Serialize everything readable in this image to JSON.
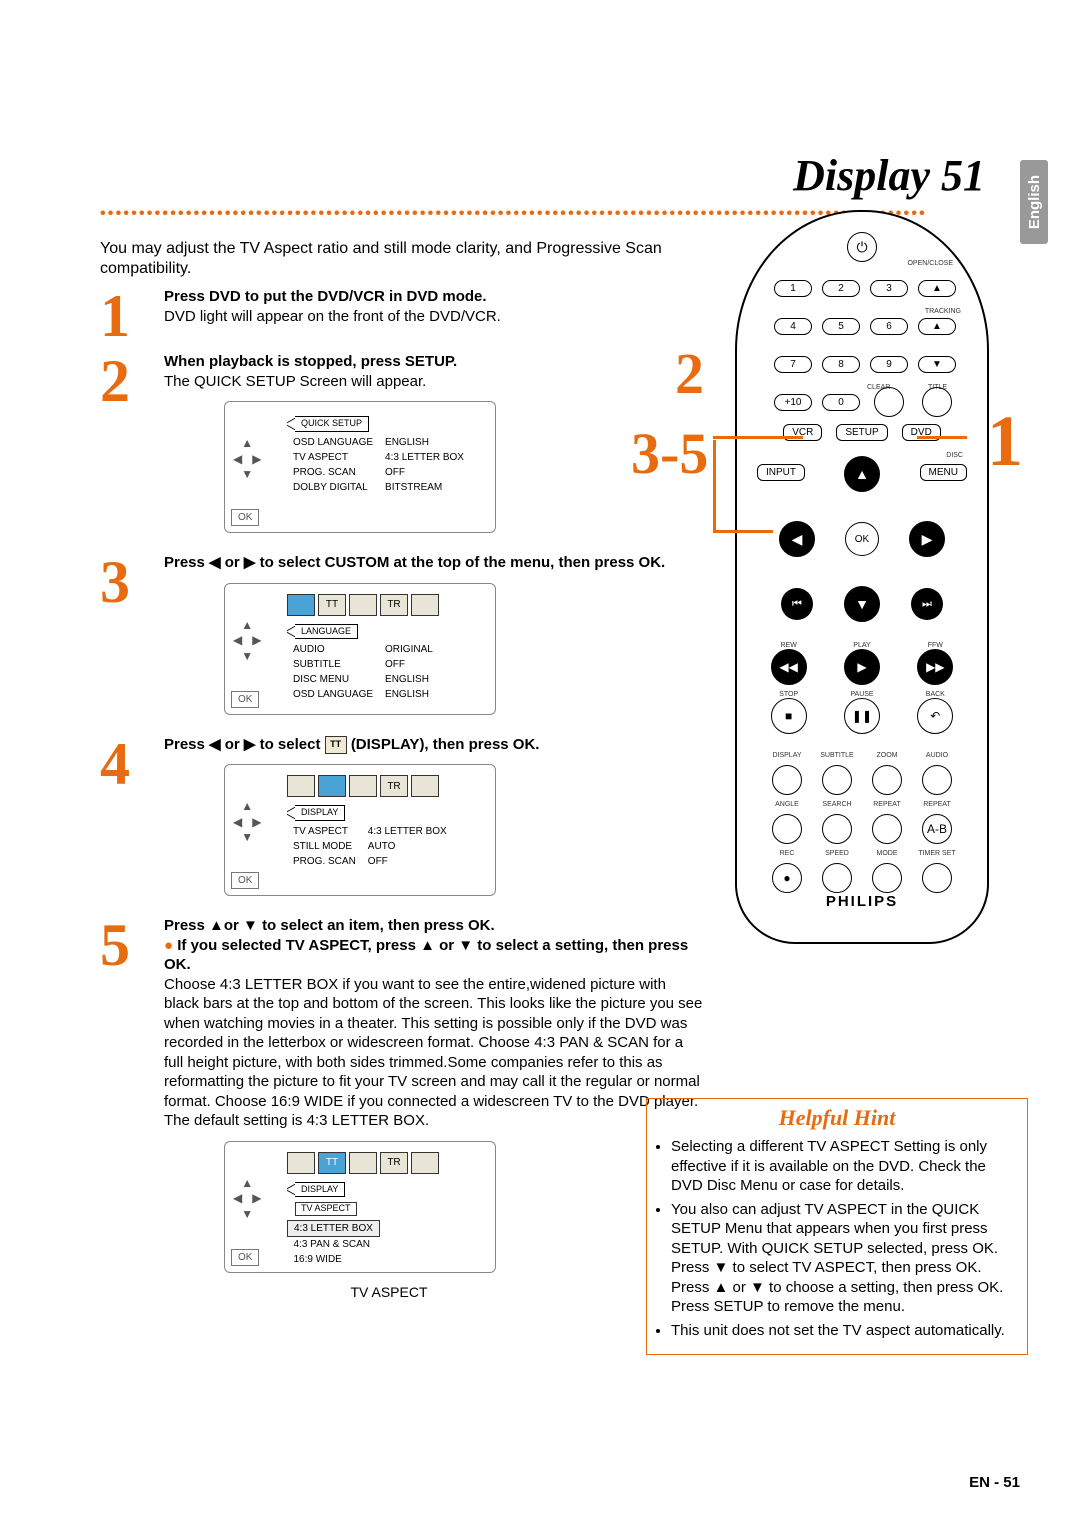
{
  "title": "Display 51",
  "langtab": "English",
  "intro": "You may adjust the TV Aspect ratio and still mode clarity, and Progressive Scan compatibility.",
  "steps": {
    "1": {
      "head": "Press DVD to put the DVD/VCR in DVD mode.",
      "body": "DVD light will appear on the front of the DVD/VCR."
    },
    "2": {
      "head": "When playback is stopped, press SETUP.",
      "body": "The QUICK SETUP Screen will appear."
    },
    "3": {
      "head": "Press ◀ or ▶ to select CUSTOM at the top of the menu, then press OK."
    },
    "4": {
      "head": "Press ◀ or ▶ to select",
      "head2": "(DISPLAY), then press OK."
    },
    "5": {
      "head": "Press ▲or ▼ to select an item, then press OK.",
      "bullet": "If you selected TV ASPECT, press ▲ or ▼ to select a setting, then press OK.",
      "body": "Choose 4:3 LETTER BOX if you want to see the entire,widened picture with black bars at the top and bottom of the screen. This looks like the picture you see when watching movies in a theater. This setting is possible only if the DVD was recorded in the letterbox or widescreen format. Choose 4:3 PAN & SCAN for a full height picture, with both sides trimmed.Some companies refer to this as reformatting the picture to fit your TV screen and may call it the regular or normal format. Choose 16:9 WIDE if you connected a widescreen TV to the DVD player.",
      "def": "The default setting is 4:3 LETTER BOX."
    }
  },
  "osd": {
    "ok": "OK",
    "quick": {
      "title": "QUICK SETUP",
      "rows": [
        [
          "OSD LANGUAGE",
          "ENGLISH"
        ],
        [
          "TV ASPECT",
          "4:3 LETTER BOX"
        ],
        [
          "PROG. SCAN",
          "OFF"
        ],
        [
          "DOLBY DIGITAL",
          "BITSTREAM"
        ]
      ]
    },
    "lang": {
      "title": "LANGUAGE",
      "rows": [
        [
          "AUDIO",
          "ORIGINAL"
        ],
        [
          "SUBTITLE",
          "OFF"
        ],
        [
          "DISC MENU",
          "ENGLISH"
        ],
        [
          "OSD LANGUAGE",
          "ENGLISH"
        ]
      ]
    },
    "disp": {
      "title": "DISPLAY",
      "rows": [
        [
          "TV ASPECT",
          "4:3 LETTER BOX"
        ],
        [
          "STILL MODE",
          "AUTO"
        ],
        [
          "PROG. SCAN",
          "OFF"
        ]
      ]
    },
    "aspect": {
      "title": "DISPLAY",
      "sub": "TV ASPECT",
      "rows": [
        "4:3 LETTER BOX",
        "4:3 PAN & SCAN",
        "16:9 WIDE"
      ],
      "caption": "TV ASPECT"
    },
    "tabs": [
      "",
      "TT",
      "",
      "TR",
      ""
    ]
  },
  "hint": {
    "title": "Helpful Hint",
    "items": [
      "Selecting a different TV ASPECT Setting is only effective if it is available on the DVD. Check the DVD Disc Menu or case for details.",
      "You also can adjust TV ASPECT in the QUICK SETUP Menu that appears when you first press SETUP. With QUICK SETUP selected, press OK. Press ▼ to select TV ASPECT, then press OK. Press ▲ or ▼ to choose a setting, then press OK. Press SETUP to remove the menu.",
      "This unit does not set the TV aspect automatically."
    ]
  },
  "remote": {
    "open": "OPEN/CLOSE",
    "tracking": "TRACKING",
    "clear": "CLEAR",
    "titleL": "TITLE",
    "nums": [
      "1",
      "2",
      "3",
      "4",
      "5",
      "6",
      "7",
      "8",
      "9",
      "+10",
      "0"
    ],
    "vcr": "VCR",
    "setup": "SETUP",
    "dvd": "DVD",
    "input": "INPUT",
    "disc": "DISC",
    "menu": "MENU",
    "ok": "OK",
    "rew": "REW",
    "play": "PLAY",
    "ffw": "FFW",
    "stop": "STOP",
    "pause": "PAUSE",
    "back": "BACK",
    "row1": [
      "DISPLAY",
      "SUBTITLE",
      "ZOOM",
      "AUDIO"
    ],
    "row2": [
      "ANGLE",
      "SEARCH",
      "REPEAT",
      "REPEAT"
    ],
    "ab": "A-B",
    "row3": [
      "REC",
      "SPEED",
      "MODE",
      "TIMER SET"
    ],
    "brand": "PHILIPS"
  },
  "callouts": {
    "c1": "1",
    "c2": "2",
    "c35": "3-5"
  },
  "footer": "EN - 51"
}
